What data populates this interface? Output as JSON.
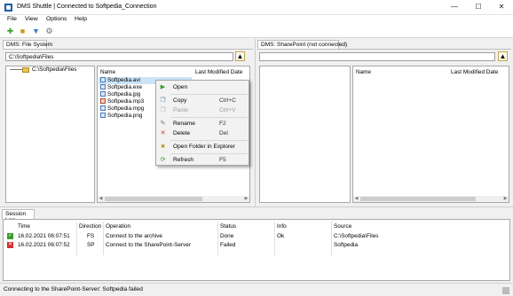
{
  "window": {
    "title": "DMS Shuttle | Connected to Softpedia_Connection",
    "minimize_icon": "minimize-icon",
    "maximize_icon": "maximize-icon",
    "close_icon": "close-icon"
  },
  "menu": [
    "File",
    "View",
    "Options",
    "Help"
  ],
  "toolbar": {
    "icons": [
      "new-document-icon",
      "open-folder-icon",
      "filter-icon",
      "settings-gear-icon"
    ]
  },
  "left_panel": {
    "tab": "DMS: File System",
    "path": "C:\\Softpedia\\Files",
    "tree_item": "C:\\Softpedia\\Files",
    "columns": [
      "Name",
      "Last Modified Date"
    ],
    "files": [
      "Softpedia.avi",
      "Softpedia.exe",
      "Softpedia.jpg",
      "Softpedia.mp3",
      "Softpedia.mpg",
      "Softpedia.png"
    ]
  },
  "right_panel": {
    "tab": "DMS: SharePoint (not connected)",
    "path": "",
    "columns": [
      "Name",
      "Last Modified Date"
    ]
  },
  "context_menu": [
    {
      "label": "Open",
      "shortcut": "",
      "icon": "open-icon",
      "enabled": true
    },
    {
      "label": "Copy",
      "shortcut": "Ctrl+C",
      "icon": "copy-icon",
      "enabled": true
    },
    {
      "label": "Paste",
      "shortcut": "Ctrl+V",
      "icon": "paste-icon",
      "enabled": false
    },
    {
      "label": "Rename",
      "shortcut": "F2",
      "icon": "rename-icon",
      "enabled": true
    },
    {
      "label": "Delete",
      "shortcut": "Del",
      "icon": "delete-icon",
      "enabled": true
    },
    {
      "label": "Open Folder in Explorer",
      "shortcut": "",
      "icon": "explorer-icon",
      "enabled": true
    },
    {
      "label": "Refresh",
      "shortcut": "F5",
      "icon": "refresh-icon",
      "enabled": true
    }
  ],
  "session_log": {
    "tab": "Session Log",
    "columns": [
      "Time",
      "Direction",
      "Operation",
      "Status",
      "Info",
      "Source"
    ],
    "rows": [
      {
        "status_icon": "success-check-icon",
        "time": "16.02.2021 06:07:51",
        "direction": "FS",
        "operation": "Connect to the archive",
        "status": "Done",
        "info": "Ok",
        "source": "C:\\Softpedia\\Files"
      },
      {
        "status_icon": "error-x-icon",
        "time": "16.02.2021 06:07:52",
        "direction": "SP",
        "operation": "Connect to the SharePoint-Server",
        "status": "Failed",
        "info": "",
        "source": "Softpedia"
      }
    ]
  },
  "status_bar": "Connecting to the SharePoint-Server: Softpedia failed",
  "colors": {
    "selection": "#cce4f7",
    "accent": "#1f5fa8",
    "success": "#3c9a2e",
    "error": "#d32f2f"
  }
}
